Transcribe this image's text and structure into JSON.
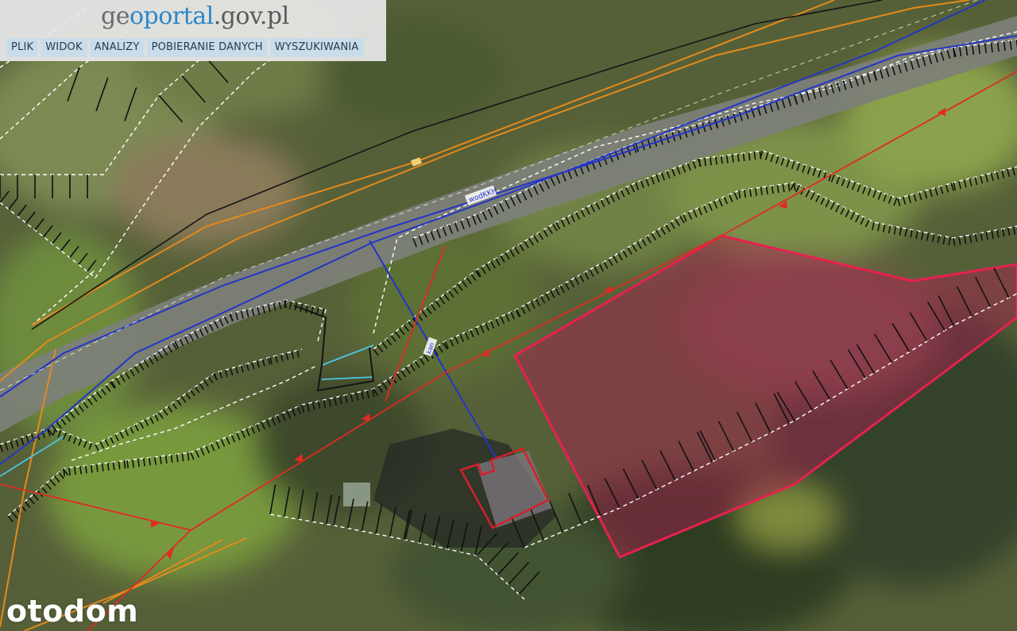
{
  "header": {
    "logo_part1": "ge",
    "logo_part2": "oportal",
    "logo_part3": ".gov.pl"
  },
  "menu": {
    "items": [
      {
        "label": "PLIK"
      },
      {
        "label": "WIDOK"
      },
      {
        "label": "ANALIZY"
      },
      {
        "label": "POBIERANIE DANYCH"
      },
      {
        "label": "WYSZUKIWANIA"
      }
    ]
  },
  "map": {
    "road_label": "wodKKH",
    "pipe_label": "kan",
    "colors": {
      "parcel_outline": "#e8204e",
      "parcel_fill": "#b01c52",
      "building_outline": "#d4202a",
      "boundary_red": "#e02a22",
      "road_blue": "#2434c8",
      "gas_orange": "#e48a1c",
      "water_cyan": "#4ec6e4"
    }
  },
  "watermark": {
    "text": "otodom"
  }
}
